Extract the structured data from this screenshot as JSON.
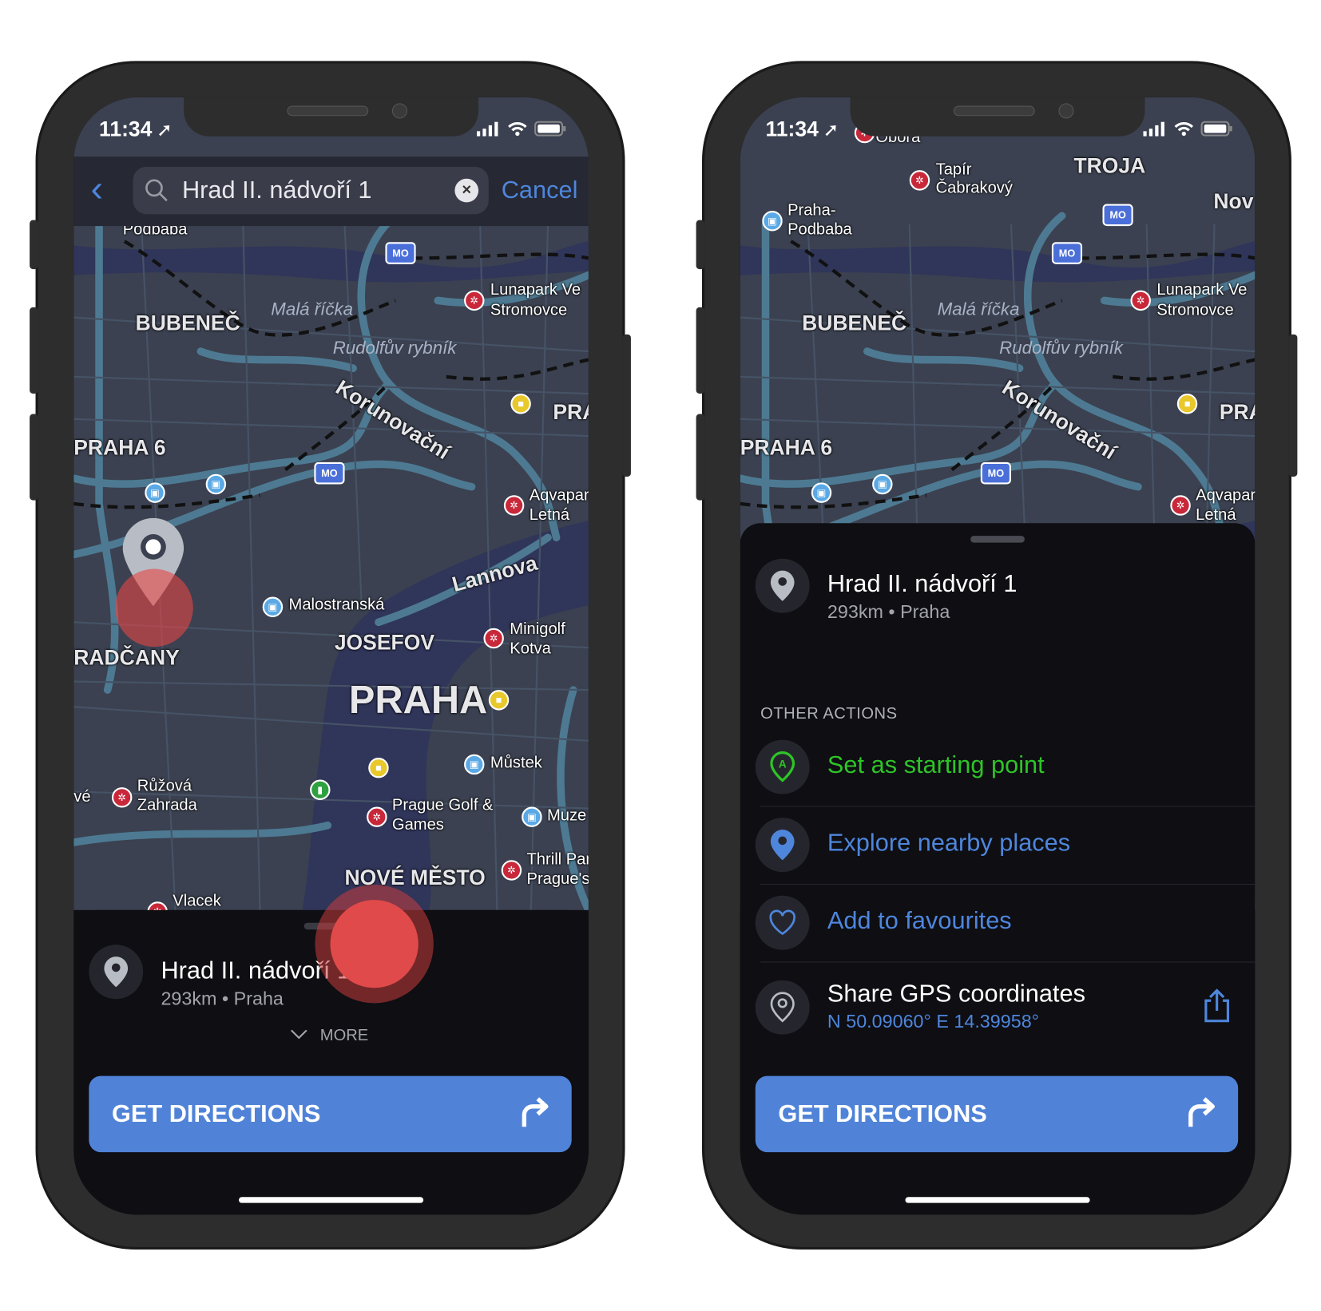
{
  "status": {
    "time": "11:34"
  },
  "left": {
    "search": {
      "value": "Hrad II. nádvoří 1",
      "cancel_label": "Cancel"
    },
    "map": {
      "labels": [
        "Podbaba",
        "Malá říčka",
        "BUBENEČ",
        "Lunapark Ve",
        "Stromovce",
        "Rudolfův rybník",
        "Korunovační",
        "PRA",
        "PRAHA 6",
        "Aqvapark",
        "Letná",
        "Lannova",
        "Malostranská",
        "Minigolf",
        "Kotva",
        "JOSEFOV",
        "RADČANY",
        "PRAHA",
        "Můstek",
        "Růžová",
        "Zahrada",
        "Prague Golf &",
        "Games",
        "Muze",
        "Thrill Par",
        "Prague's",
        "NOVÉ MĚSTO",
        "Vlacek",
        "vé"
      ],
      "badge": "MO"
    },
    "place": {
      "title": "Hrad II. nádvoří 1",
      "distance": "293km",
      "city": "Praha",
      "separator": "•"
    },
    "more_label": "MORE",
    "cta_label": "GET DIRECTIONS"
  },
  "right": {
    "map": {
      "labels": [
        "Tapír",
        "Čabrakový",
        "TROJA",
        "Praha-",
        "Podbaba",
        "Nov",
        "Malá říčka",
        "BUBENEČ",
        "Lunapark Ve",
        "Stromovce",
        "Rudolfův rybník",
        "Korunovační",
        "PRA",
        "PRAHA 6",
        "Aqvapark",
        "Letná",
        "Obora"
      ],
      "badge": "MO"
    },
    "place": {
      "title": "Hrad II. nádvoří 1",
      "distance": "293km",
      "city": "Praha",
      "separator": "•"
    },
    "section_label": "OTHER ACTIONS",
    "actions": [
      {
        "label": "Set as starting point",
        "icon": "start-point-icon",
        "color": "#2ec427"
      },
      {
        "label": "Explore nearby places",
        "icon": "pin-icon",
        "color": "#4e86dc"
      },
      {
        "label": "Add to favourites",
        "icon": "heart-icon",
        "color": "#4e86dc"
      },
      {
        "label": "Share GPS coordinates",
        "sub": "N 50.09060° E 14.39958°",
        "icon": "location-icon",
        "color": "#ffffff"
      }
    ],
    "cta_label": "GET DIRECTIONS"
  },
  "colors": {
    "accent": "#5083d8",
    "link": "#4e86dc",
    "green": "#2ec427",
    "sheet": "#0e0e13",
    "map": "#3b4150"
  }
}
